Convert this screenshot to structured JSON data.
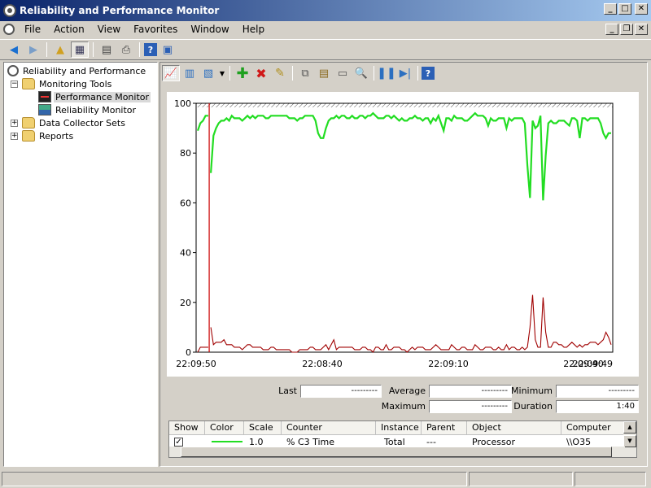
{
  "window": {
    "title": "Reliability and Performance Monitor"
  },
  "menu": [
    "File",
    "Action",
    "View",
    "Favorites",
    "Window",
    "Help"
  ],
  "tree": {
    "root": "Reliability and Performance",
    "monitoring_tools": "Monitoring Tools",
    "performance_monitor": "Performance Monitor",
    "reliability_monitor": "Reliability Monitor",
    "data_collector_sets": "Data Collector Sets",
    "reports": "Reports"
  },
  "chart_data": {
    "type": "line",
    "ylim": [
      0,
      100
    ],
    "yticks": [
      0,
      20,
      40,
      60,
      80,
      100
    ],
    "x_tick_labels": [
      "22:09:50",
      "22:08:40",
      "22:09:10",
      "22:09:40",
      "22:09:49"
    ],
    "series": [
      {
        "name": "% C3 Time",
        "color": "#22dd22",
        "values": [
          89,
          92,
          93,
          95,
          95,
          72,
          87,
          90,
          92,
          93,
          93,
          94,
          93,
          95,
          94,
          94,
          94,
          93,
          94,
          95,
          94,
          95,
          94,
          95,
          95,
          95,
          94,
          94,
          95,
          95,
          95,
          95,
          95,
          95,
          95,
          94,
          94,
          94,
          93,
          94,
          94,
          95,
          95,
          95,
          95,
          93,
          88,
          86,
          86,
          90,
          93,
          94,
          94,
          95,
          94,
          95,
          95,
          94,
          94,
          95,
          94,
          94,
          95,
          95,
          94,
          95,
          95,
          96,
          95,
          94,
          94,
          94,
          95,
          95,
          94,
          95,
          94,
          93,
          94,
          93,
          93,
          94,
          94,
          95,
          94,
          94,
          93,
          94,
          94,
          92,
          94,
          93,
          95,
          92,
          89,
          94,
          94,
          93,
          95,
          94,
          94,
          94,
          93,
          93,
          94,
          95,
          96,
          95,
          95,
          95,
          94,
          91,
          94,
          93,
          93,
          94,
          94,
          94,
          90,
          94,
          93,
          94,
          94,
          94,
          94,
          92,
          75,
          62,
          93,
          90,
          91,
          95,
          61,
          79,
          92,
          93,
          92,
          92,
          93,
          93,
          93,
          92,
          91,
          94,
          94,
          93,
          86,
          94,
          94,
          93,
          94,
          94,
          94,
          94,
          92,
          88,
          86,
          88,
          88
        ],
        "break_index": 5
      },
      {
        "name": "",
        "color": "#a00000",
        "values": [
          0,
          2,
          2,
          2,
          2,
          10,
          3,
          4,
          4,
          4,
          5,
          3,
          3,
          3,
          2,
          2,
          2,
          1,
          2,
          3,
          3,
          2,
          2,
          2,
          2,
          1,
          1,
          1,
          2,
          2,
          1,
          1,
          1,
          1,
          1,
          1,
          0,
          0,
          0,
          1,
          1,
          1,
          1,
          2,
          2,
          1,
          1,
          1,
          2,
          3,
          1,
          3,
          5,
          1,
          2,
          2,
          2,
          2,
          2,
          2,
          1,
          1,
          1,
          2,
          2,
          1,
          1,
          0,
          2,
          2,
          1,
          1,
          3,
          1,
          1,
          2,
          2,
          2,
          1,
          1,
          0,
          1,
          2,
          1,
          2,
          2,
          2,
          1,
          1,
          1,
          2,
          3,
          2,
          1,
          1,
          1,
          1,
          3,
          2,
          1,
          1,
          2,
          2,
          1,
          1,
          1,
          3,
          2,
          1,
          1,
          2,
          2,
          2,
          1,
          1,
          2,
          1,
          1,
          3,
          1,
          2,
          2,
          1,
          1,
          2,
          1,
          2,
          10,
          23,
          5,
          2,
          2,
          22,
          8,
          2,
          2,
          4,
          4,
          3,
          3,
          2,
          2,
          3,
          4,
          3,
          2,
          3,
          2,
          3,
          3,
          4,
          4,
          4,
          3,
          4,
          5,
          8,
          6,
          3
        ],
        "break_index": 5
      }
    ],
    "current_index": 5
  },
  "stats": {
    "last_label": "Last",
    "last_value": "---------",
    "average_label": "Average",
    "average_value": "---------",
    "minimum_label": "Minimum",
    "minimum_value": "---------",
    "maximum_label": "Maximum",
    "maximum_value": "---------",
    "duration_label": "Duration",
    "duration_value": "1:40"
  },
  "legend": {
    "columns": [
      "Show",
      "Color",
      "Scale",
      "Counter",
      "Instance",
      "Parent",
      "Object",
      "Computer"
    ],
    "row": {
      "show": "✓",
      "color": "#22dd22",
      "scale": "1.0",
      "counter": "% C3 Time",
      "instance": "Total",
      "parent": "---",
      "object": "Processor",
      "computer": "\\\\O35"
    }
  },
  "icons": {
    "back": "back-arrow-icon",
    "forward": "forward-arrow-icon",
    "add": "add-counter-icon",
    "delete": "delete-counter-icon",
    "highlight": "highlight-icon",
    "freeze": "pause-icon",
    "update": "next-frame-icon",
    "help": "help-icon"
  }
}
